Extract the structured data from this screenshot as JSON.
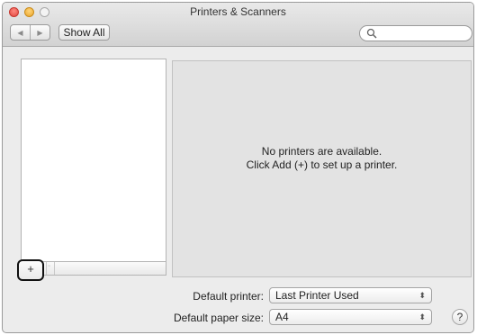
{
  "window": {
    "title": "Printers & Scanners"
  },
  "toolbar": {
    "back_glyph": "◀",
    "forward_glyph": "▶",
    "show_all_label": "Show All",
    "search_placeholder": "",
    "search_icon": "magnifier-icon"
  },
  "printer_list": {
    "add_label": "+",
    "remove_label": "-"
  },
  "detail": {
    "empty_line1": "No printers are available.",
    "empty_line2": "Click Add (+) to set up a printer."
  },
  "settings": {
    "default_printer_label": "Default printer:",
    "default_printer_value": "Last Printer Used",
    "paper_size_label": "Default paper size:",
    "paper_size_value": "A4",
    "popup_arrows": "⬍"
  },
  "help": {
    "label": "?"
  },
  "colors": {
    "window_bg": "#ececec",
    "detail_bg": "#e3e3e3",
    "close_red": "#e0443e",
    "minimize_yellow": "#e9a42a",
    "highlight_border": "#111111"
  }
}
